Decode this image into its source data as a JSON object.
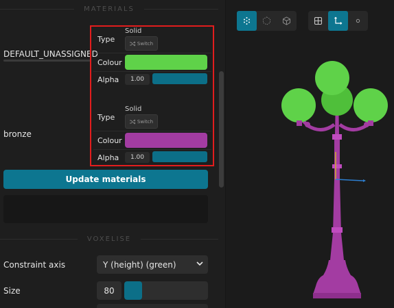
{
  "sections": {
    "materials_title": "MATERIALS",
    "voxelise_title": "VOXELISE"
  },
  "materials": [
    {
      "name": "DEFAULT_UNASSIGNED",
      "type_label": "Type",
      "type_value": "Solid",
      "switch_label": "Switch",
      "colour_label": "Colour",
      "colour": "#5fd249",
      "alpha_label": "Alpha",
      "alpha_value": "1.00",
      "alpha": 1.0
    },
    {
      "name": "bronze",
      "type_label": "Type",
      "type_value": "Solid",
      "switch_label": "Switch",
      "colour_label": "Colour",
      "colour": "#a33ca2",
      "alpha_label": "Alpha",
      "alpha_value": "1.00",
      "alpha": 1.0
    }
  ],
  "update_button": "Update materials",
  "voxelise": {
    "constraint_axis_label": "Constraint axis",
    "constraint_axis_value": "Y (height) (green)",
    "size_label": "Size",
    "size_value": "80",
    "size_fraction": 0.21
  },
  "colors": {
    "accent": "#0d7690",
    "highlight_box": "#e21d1d",
    "model_green": "#5fd249",
    "model_purple": "#a33ca2",
    "gizmo_blue": "#2d7fd1"
  },
  "viewport_toolbar": {
    "group1": [
      {
        "icon": "voxel-points-icon",
        "active": true
      },
      {
        "icon": "voxel-cube-dotted-icon",
        "active": false
      },
      {
        "icon": "mesh-cube-icon",
        "active": false
      }
    ],
    "group2": [
      {
        "icon": "grid-icon",
        "active": false
      },
      {
        "icon": "axes-icon",
        "active": true
      },
      {
        "icon": "pivot-dot-icon",
        "active": false
      }
    ]
  }
}
